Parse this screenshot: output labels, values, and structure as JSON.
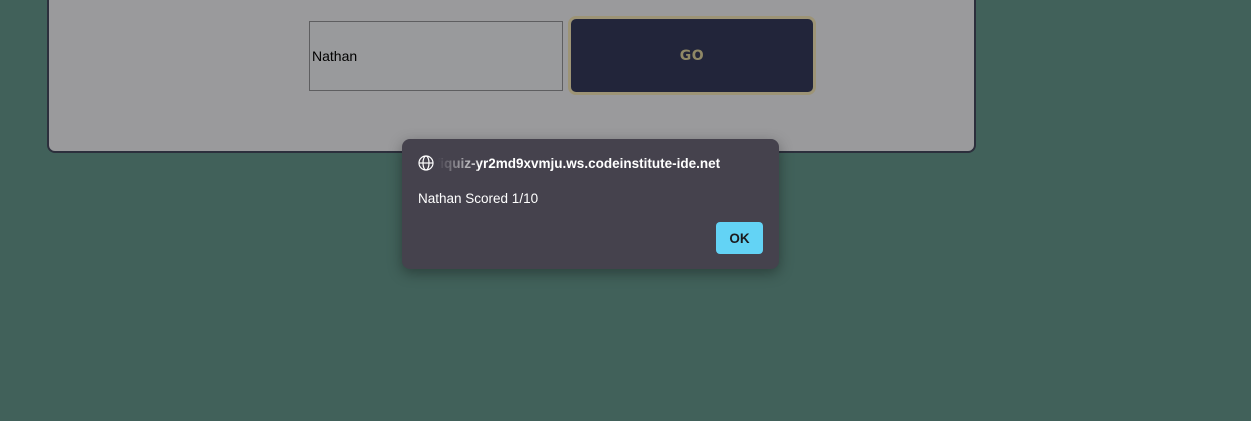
{
  "quiz": {
    "name_input_value": "Nathan",
    "go_label": "GO"
  },
  "alert": {
    "origin": "perscifiquiz-yr2md9xvmju.ws.codeinstitute-ide.net",
    "message": "Nathan Scored 1/10",
    "ok_label": "OK",
    "icon": "globe-icon"
  },
  "colors": {
    "page_background": "#41615a",
    "panel_background": "#9a9a9c",
    "go_button_background": "#22253a",
    "go_button_text": "#8f8866",
    "dialog_background": "#45424d",
    "ok_button_background": "#63d3f5"
  }
}
